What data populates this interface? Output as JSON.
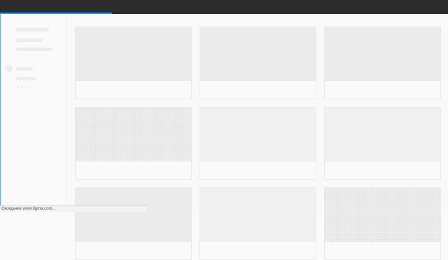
{
  "browser": {
    "loading_progress_percent": 25,
    "status_text": "Ожидание www.figma.com..."
  },
  "colors": {
    "topbar": "#2c2c2c",
    "progress": "#18a0fb",
    "skeleton": "#ebebeb",
    "background": "#fafafa"
  },
  "sidebar": {
    "more_indicator": "• • •"
  }
}
